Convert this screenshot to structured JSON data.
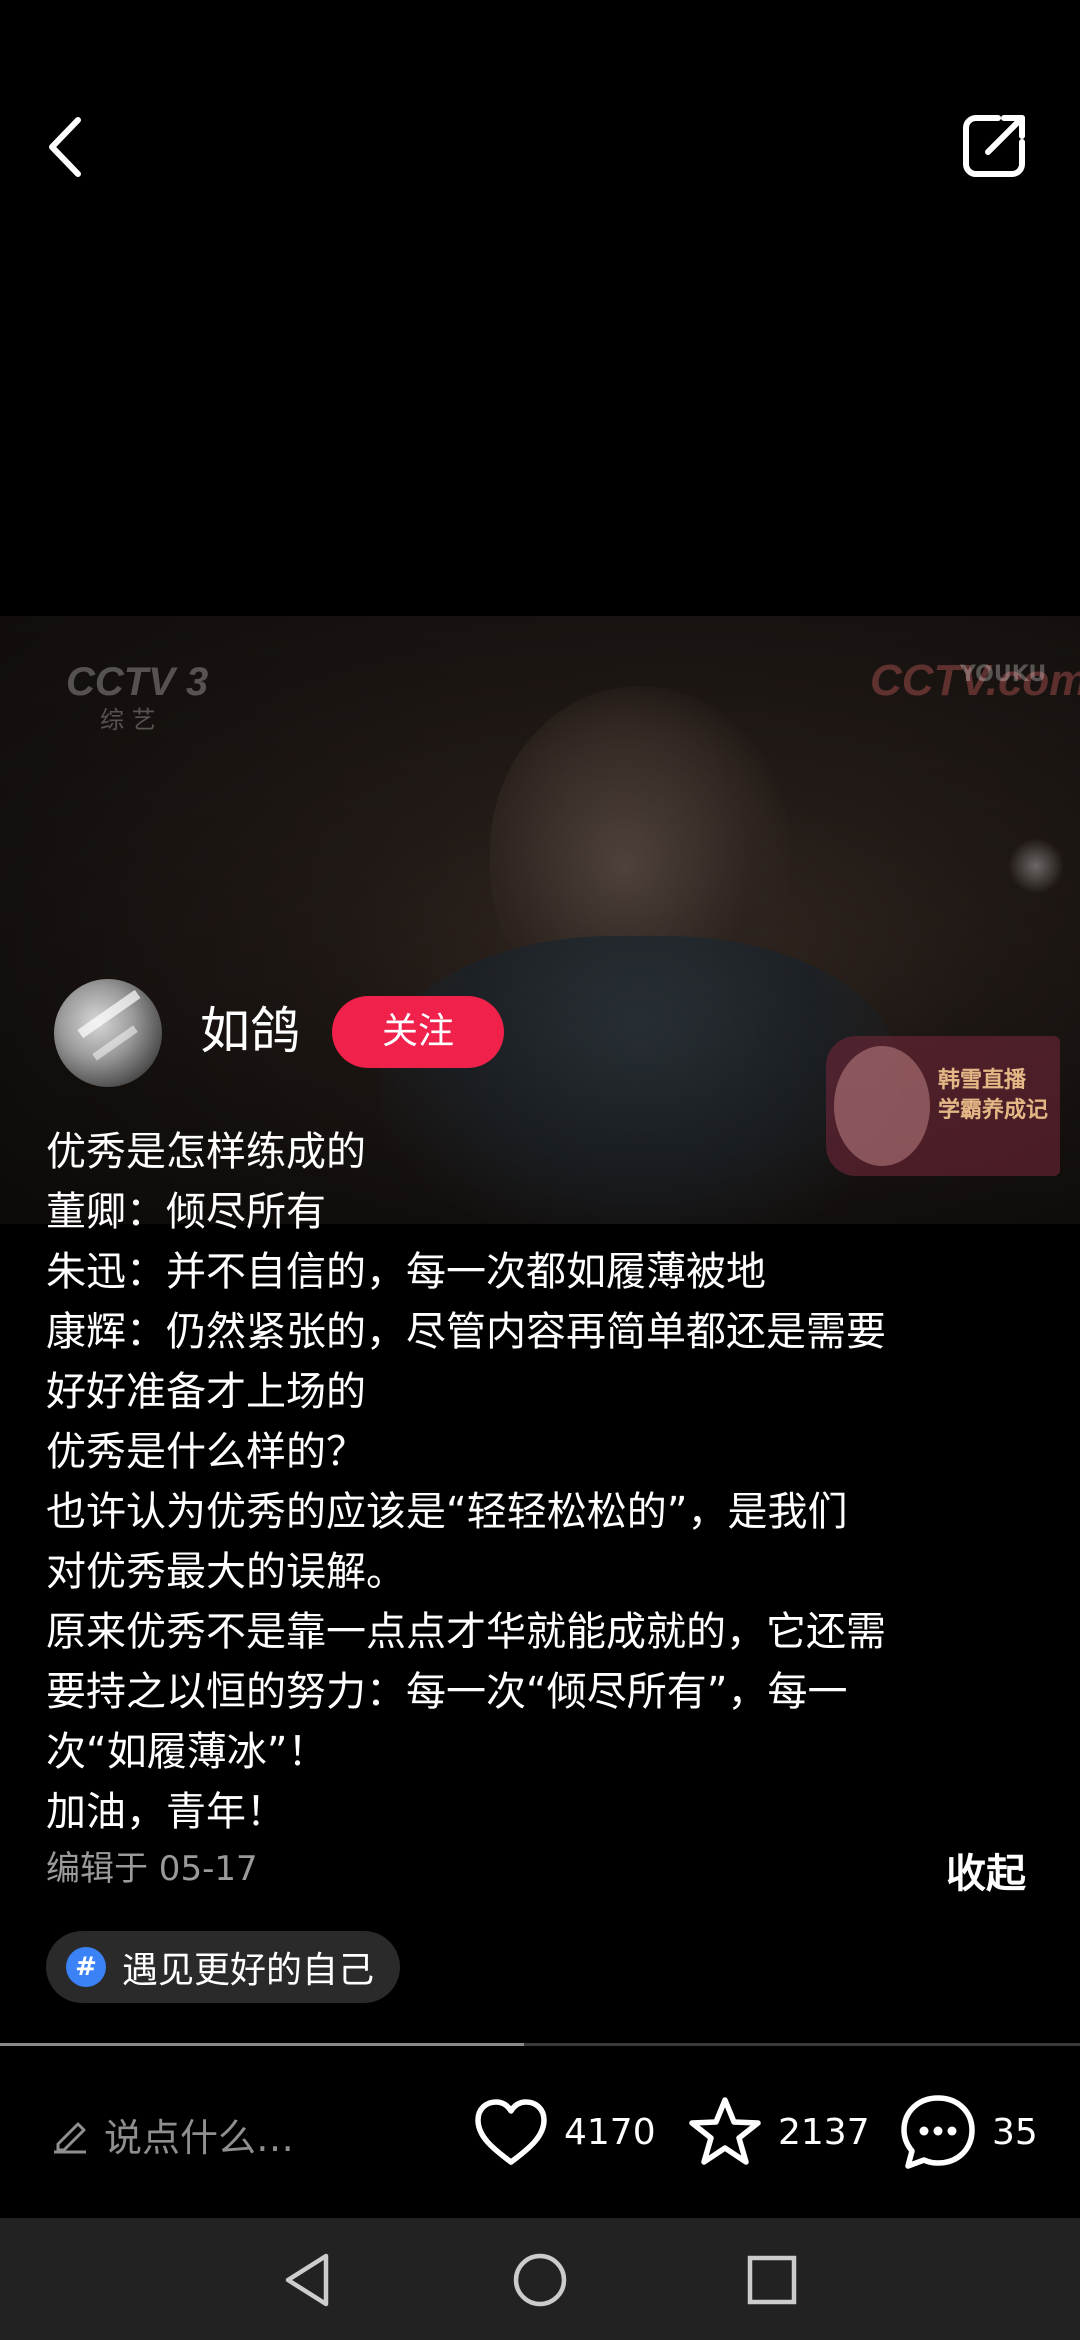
{
  "icons": {
    "back": "chevron-left-icon",
    "share": "share-external-icon",
    "edit": "pencil-icon",
    "like": "heart-icon",
    "favorite": "star-icon",
    "comment": "chat-bubble-icon",
    "topic": "hashtag-icon",
    "nav_back": "triangle-back-icon",
    "nav_home": "circle-home-icon",
    "nav_recent": "square-recent-icon"
  },
  "colors": {
    "follow_button": "#f0214b",
    "topic_hash": "#3b82f6",
    "background": "#000000"
  },
  "video": {
    "watermark_left": "CCTV 3",
    "watermark_left_sub": "综 艺",
    "watermark_right": "CCTV.com",
    "watermark_right_badge": "YOUKU",
    "ad_text_line1": "韩雪直播",
    "ad_text_line2": "学霸养成记"
  },
  "author": {
    "name": "如鸽",
    "follow_label": "关注"
  },
  "post": {
    "lines": [
      "优秀是怎样练成的",
      "董卿：倾尽所有",
      "朱迅：并不自信的，每一次都如履薄被地",
      "康辉：仍然紧张的，尽管内容再简单都还是需要",
      "好好准备才上场的",
      "优秀是什么样的？",
      "也许认为优秀的应该是“轻轻松松的”，是我们",
      "对优秀最大的误解。",
      "原来优秀不是靠一点点才华就能成就的，它还需",
      "要持之以恒的努力：每一次“倾尽所有”，每一",
      "次“如履薄冰”！",
      "加油，青年！"
    ],
    "edit_time": "编辑于 05-17",
    "collapse_label": "收起"
  },
  "topic": {
    "hash_symbol": "#",
    "label": "遇见更好的自己"
  },
  "progress": {
    "fraction": 0.485
  },
  "actions": {
    "comment_placeholder": "说点什么…",
    "like_count": "4170",
    "favorite_count": "2137",
    "comment_count": "35"
  }
}
